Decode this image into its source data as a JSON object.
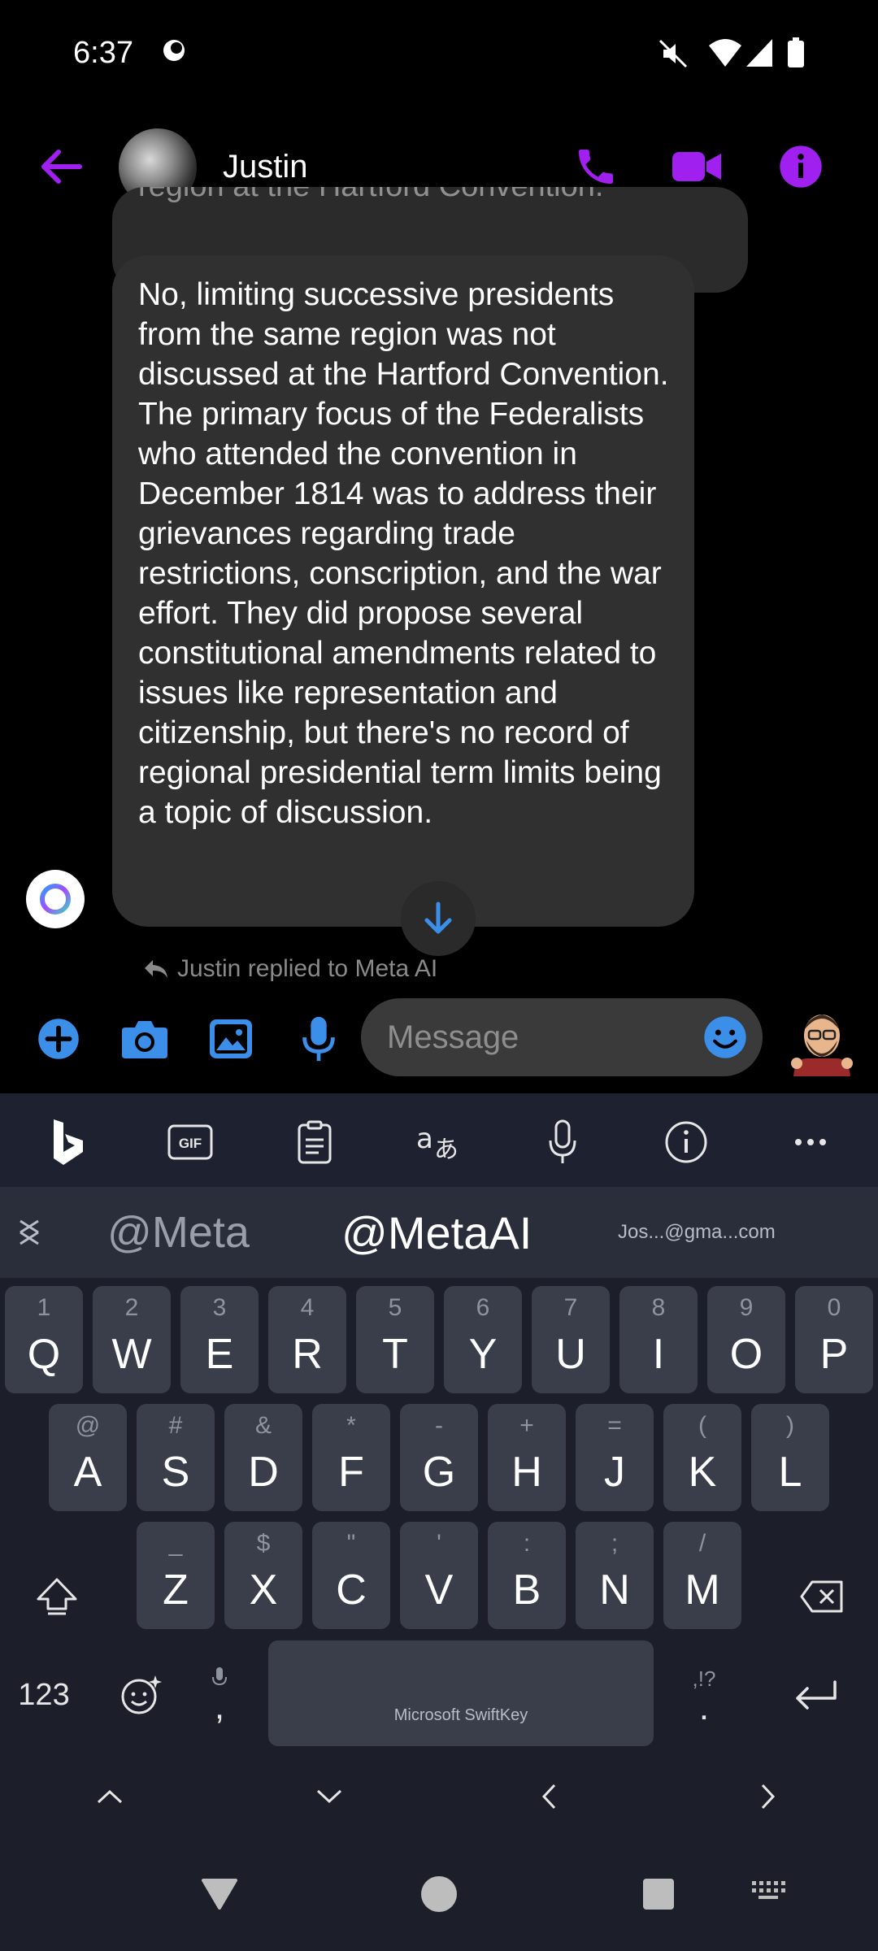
{
  "status_bar": {
    "time": "6:37"
  },
  "header": {
    "contact_name": "Justin"
  },
  "messages": {
    "previous_partial": "region at the Hartford Convention.",
    "main": "No, limiting successive presidents from the same region was not discussed at the Hartford Convention. The primary focus of the Federalists who attended the convention in December 1814 was to address their grievances regarding trade restrictions, conscription, and the war effort. They did propose several constitutional amendments related to issues like representation and citizenship, but there's no record of regional presidential term limits being a topic of discussion."
  },
  "reply_note": "Justin replied to Meta AI",
  "composer": {
    "placeholder": "Message"
  },
  "keyboard": {
    "suggestions": [
      "@Meta",
      "@MetaAI",
      "Jos...@gma...com"
    ],
    "row1": [
      [
        "Q",
        "1"
      ],
      [
        "W",
        "2"
      ],
      [
        "E",
        "3"
      ],
      [
        "R",
        "4"
      ],
      [
        "T",
        "5"
      ],
      [
        "Y",
        "6"
      ],
      [
        "U",
        "7"
      ],
      [
        "I",
        "8"
      ],
      [
        "O",
        "9"
      ],
      [
        "P",
        "0"
      ]
    ],
    "row2": [
      [
        "A",
        "@"
      ],
      [
        "S",
        "#"
      ],
      [
        "D",
        "&"
      ],
      [
        "F",
        "*"
      ],
      [
        "G",
        "-"
      ],
      [
        "H",
        "+"
      ],
      [
        "J",
        "="
      ],
      [
        "K",
        "("
      ],
      [
        "L",
        ")"
      ]
    ],
    "row3": [
      [
        "Z",
        "_"
      ],
      [
        "X",
        "$"
      ],
      [
        "C",
        "\""
      ],
      [
        "V",
        "'"
      ],
      [
        "B",
        ":"
      ],
      [
        "N",
        ";"
      ],
      [
        "M",
        "/"
      ]
    ],
    "num_key": "123",
    "comma": ",",
    "period": ".",
    "period_sub": ",!?",
    "space_label": "Microsoft SwiftKey"
  },
  "colors": {
    "accent_purple": "#a020f0",
    "accent_blue": "#3b8fe8",
    "bubble": "#303030",
    "keyboard_bg": "#1c1f2a",
    "key_bg": "#3a3e4a"
  }
}
